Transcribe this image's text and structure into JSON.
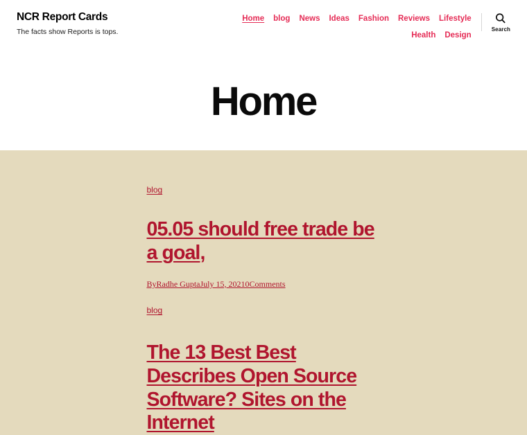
{
  "header": {
    "site_title": "NCR Report Cards",
    "tagline": "The facts show Reports is tops.",
    "nav": [
      {
        "label": "Home",
        "current": true
      },
      {
        "label": "blog",
        "current": false
      },
      {
        "label": "News",
        "current": false
      },
      {
        "label": "Ideas",
        "current": false
      },
      {
        "label": "Fashion",
        "current": false
      },
      {
        "label": "Reviews",
        "current": false
      },
      {
        "label": "Lifestyle",
        "current": false
      },
      {
        "label": "Health",
        "current": false
      },
      {
        "label": "Design",
        "current": false
      }
    ],
    "search": {
      "icon": "search-icon",
      "label": "Search"
    }
  },
  "page": {
    "title": "Home"
  },
  "posts": [
    {
      "category": "blog",
      "title_link": "05.05 should free trade be a goal",
      "title_tail": ",",
      "meta": {
        "by_prefix": "By",
        "author": "Radhe Gupta",
        "date": "July 15, 2021",
        "comments": "0Comments"
      }
    },
    {
      "category": "blog",
      "title_link": "The 13 Best Best Describes Open Source Software? Sites on the Internet",
      "title_tail": "",
      "meta": null
    }
  ],
  "colors": {
    "nav_link": "#e52b55",
    "post_accent": "#b0152e",
    "content_bg": "#e4dabd",
    "header_bg": "#ffffff",
    "title_text": "#0a0a0a"
  }
}
